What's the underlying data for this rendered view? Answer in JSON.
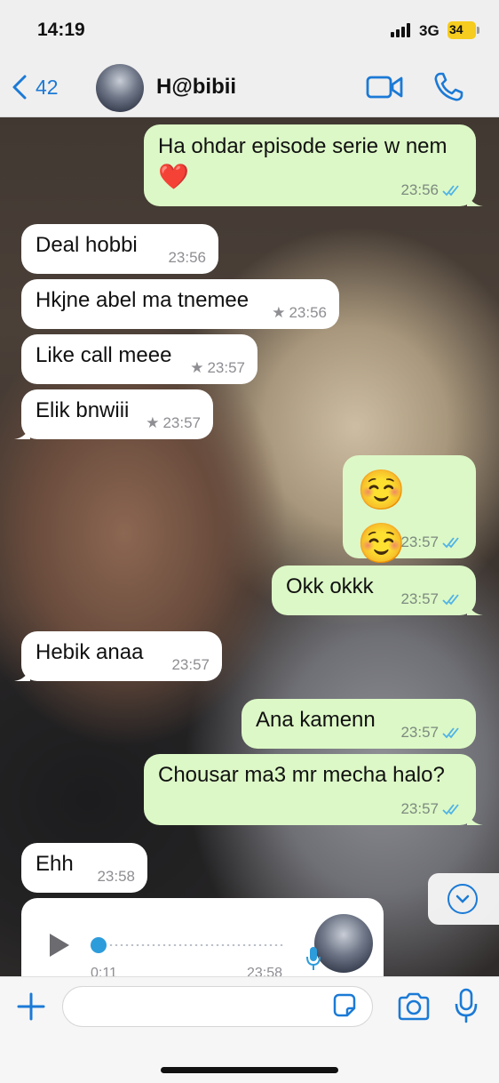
{
  "status_bar": {
    "time": "14:19",
    "network": "3G",
    "battery": "34"
  },
  "header": {
    "back_count": "42",
    "contact_name": "H@bibii"
  },
  "messages": [
    {
      "direction": "out",
      "text": "Ha ohdar episode serie w nem",
      "extra": "❤️",
      "time": "23:56",
      "starred": false
    },
    {
      "direction": "in",
      "text": "Deal hobbi",
      "time": "23:56",
      "starred": false
    },
    {
      "direction": "in",
      "text": "Hkjne abel ma tnemee",
      "time": "23:56",
      "starred": true
    },
    {
      "direction": "in",
      "text": "Like call meee",
      "time": "23:57",
      "starred": true
    },
    {
      "direction": "in",
      "text": "Elik bnwiii",
      "time": "23:57",
      "starred": true
    },
    {
      "direction": "out",
      "text": "☺️ ☺️",
      "time": "23:57",
      "starred": false
    },
    {
      "direction": "out",
      "text": "Okk okkk",
      "time": "23:57",
      "starred": false
    },
    {
      "direction": "in",
      "text": "Hebik anaa",
      "time": "23:57",
      "starred": false
    },
    {
      "direction": "out",
      "text": "Ana kamenn",
      "time": "23:57",
      "starred": false
    },
    {
      "direction": "out",
      "text": "Chousar ma3 mr mecha halo?",
      "time": "23:57",
      "starred": false
    },
    {
      "direction": "in",
      "text": "Ehh",
      "time": "23:58",
      "starred": false
    }
  ],
  "voice_note": {
    "duration": "0:11",
    "time": "23:58"
  },
  "composer": {
    "placeholder": "",
    "value": ""
  },
  "icons": {
    "back": "chevron-left-icon",
    "video": "video-camera-icon",
    "call": "phone-icon",
    "scroll": "chevron-down-icon",
    "plus": "plus-icon",
    "sticker": "sticker-icon",
    "camera": "camera-icon",
    "mic": "microphone-icon",
    "play": "play-icon"
  },
  "colors": {
    "accent": "#1b7ad6",
    "outgoing_bubble": "#dcf8c6",
    "incoming_bubble": "#ffffff",
    "read_ticks": "#4fb3e8"
  }
}
